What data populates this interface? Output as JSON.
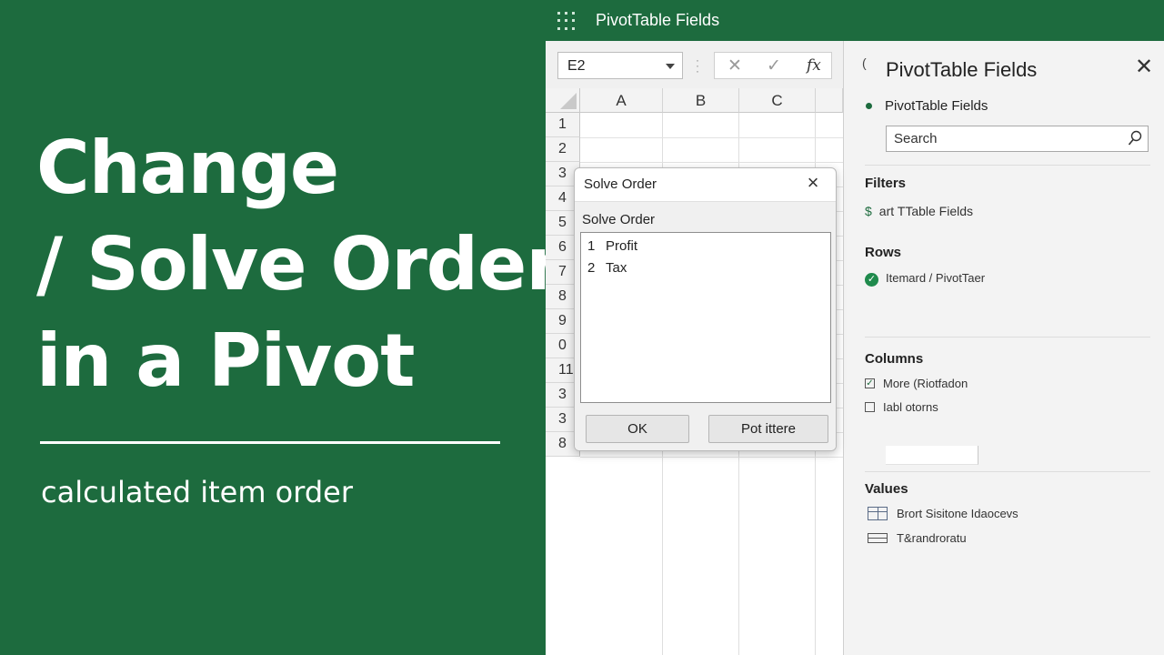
{
  "banner": {
    "headline": [
      "Change",
      "/ Solve Order /",
      "in a Pivot"
    ],
    "subtitle": "calculated item order",
    "color": "#1d6b3e"
  },
  "titlebar": {
    "title": "PivotTable Fields"
  },
  "formula_bar": {
    "name_box": "E2",
    "cancel": "✕",
    "enter": "✓",
    "fx": "fx"
  },
  "sheet": {
    "columns": [
      "A",
      "B",
      "C"
    ],
    "rows": [
      "1",
      "2",
      "3",
      "4",
      "5",
      "6",
      "7",
      "8",
      "9",
      "0",
      "11",
      "3",
      "3",
      "8"
    ]
  },
  "dialog": {
    "title": "Solve Order",
    "label": "Solve Order",
    "items": [
      {
        "num": "1",
        "name": "Profit"
      },
      {
        "num": "2",
        "name": "Tax"
      }
    ],
    "ok": "OK",
    "secondary": "Pot ittere"
  },
  "pane": {
    "title": "PivotTable Fields",
    "fields_label": "PivotTable Fields",
    "search_placeholder": "Search",
    "filters": {
      "heading": "Filters",
      "item": "art TTable Fields",
      "icon": "$"
    },
    "rows": {
      "heading": "Rows",
      "item": "Itemard / PivotTaer"
    },
    "columns": {
      "heading": "Columns",
      "items": [
        "More (Riotfadon",
        "Iabl otorns"
      ]
    },
    "values": {
      "heading": "Values",
      "items": [
        "Brort Sisitone Idaocevs",
        "T&randroratu"
      ]
    }
  }
}
